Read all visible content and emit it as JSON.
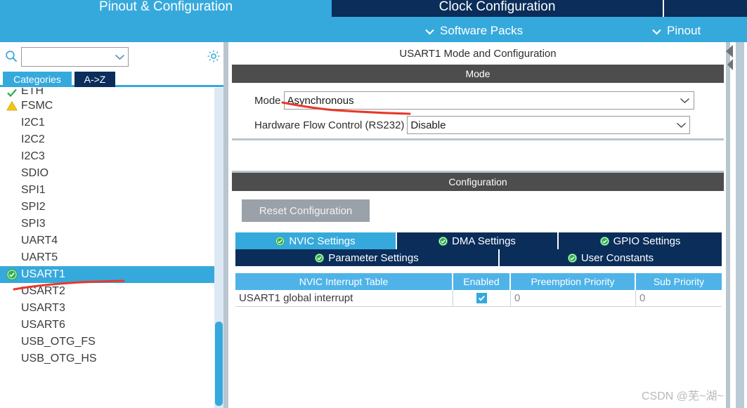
{
  "tabstrip": {
    "tabs": [
      {
        "label": "Pinout & Configuration",
        "state": "active-light"
      },
      {
        "label": "Clock Configuration",
        "state": "dark"
      },
      {
        "label": "",
        "state": "dark"
      }
    ]
  },
  "menubar": {
    "software_packs": "Software Packs",
    "pinout": "Pinout",
    "chevron": "⌵"
  },
  "sidebar": {
    "search": {
      "value": "",
      "placeholder": ""
    },
    "icons": {
      "search": "search-icon",
      "gear": "gear-icon"
    },
    "subtabs": [
      {
        "label": "Categories",
        "selected": true
      },
      {
        "label": "A->Z",
        "selected": false
      }
    ],
    "items": [
      {
        "label": "ETH",
        "status": "ok",
        "selected": false,
        "clipped": true
      },
      {
        "label": "FSMC",
        "status": "warning",
        "selected": false,
        "clipped": false
      },
      {
        "label": "I2C1",
        "status": "none",
        "selected": false,
        "clipped": false
      },
      {
        "label": "I2C2",
        "status": "none",
        "selected": false,
        "clipped": false
      },
      {
        "label": "I2C3",
        "status": "none",
        "selected": false,
        "clipped": false
      },
      {
        "label": "SDIO",
        "status": "none",
        "selected": false,
        "clipped": false
      },
      {
        "label": "SPI1",
        "status": "none",
        "selected": false,
        "clipped": false
      },
      {
        "label": "SPI2",
        "status": "none",
        "selected": false,
        "clipped": false
      },
      {
        "label": "SPI3",
        "status": "none",
        "selected": false,
        "clipped": false
      },
      {
        "label": "UART4",
        "status": "none",
        "selected": false,
        "clipped": false
      },
      {
        "label": "UART5",
        "status": "none",
        "selected": false,
        "clipped": false
      },
      {
        "label": "USART1",
        "status": "ok-filled",
        "selected": true,
        "clipped": false
      },
      {
        "label": "USART2",
        "status": "none",
        "selected": false,
        "clipped": false
      },
      {
        "label": "USART3",
        "status": "none",
        "selected": false,
        "clipped": false
      },
      {
        "label": "USART6",
        "status": "none",
        "selected": false,
        "clipped": false
      },
      {
        "label": "USB_OTG_FS",
        "status": "none",
        "selected": false,
        "clipped": false
      },
      {
        "label": "USB_OTG_HS",
        "status": "none",
        "selected": false,
        "clipped": false
      }
    ]
  },
  "panel": {
    "title": "USART1 Mode and Configuration",
    "mode_section": {
      "heading": "Mode",
      "mode_label": "Mode",
      "mode_value": "Asynchronous",
      "hfc_label": "Hardware Flow Control (RS232)",
      "hfc_value": "Disable"
    },
    "config_section": {
      "heading": "Configuration",
      "reset_label": "Reset Configuration",
      "tabs_row1": [
        {
          "label": "NVIC Settings",
          "active": true
        },
        {
          "label": "DMA Settings",
          "active": false
        },
        {
          "label": "GPIO Settings",
          "active": false
        }
      ],
      "tabs_row2": [
        {
          "label": "Parameter Settings",
          "active": false
        },
        {
          "label": "User Constants",
          "active": false
        }
      ],
      "table": {
        "headers": [
          "NVIC Interrupt Table",
          "Enabled",
          "Preemption Priority",
          "Sub Priority"
        ],
        "rows": [
          {
            "name": "USART1 global interrupt",
            "enabled": true,
            "preemption_priority": "0",
            "sub_priority": "0"
          }
        ]
      }
    }
  },
  "watermark": "CSDN @芜~湖~",
  "colors": {
    "accent_light_blue": "#36a9dc",
    "accent_dark_navy": "#0a2d5a",
    "section_header_gray": "#4d4d4d",
    "table_header_blue": "#4fb3e8",
    "status_ok_green": "#2eaf4e",
    "status_warning_yellow": "#f2c31a",
    "annotation_red": "#e8382b",
    "button_gray": "#9aa1a8"
  }
}
